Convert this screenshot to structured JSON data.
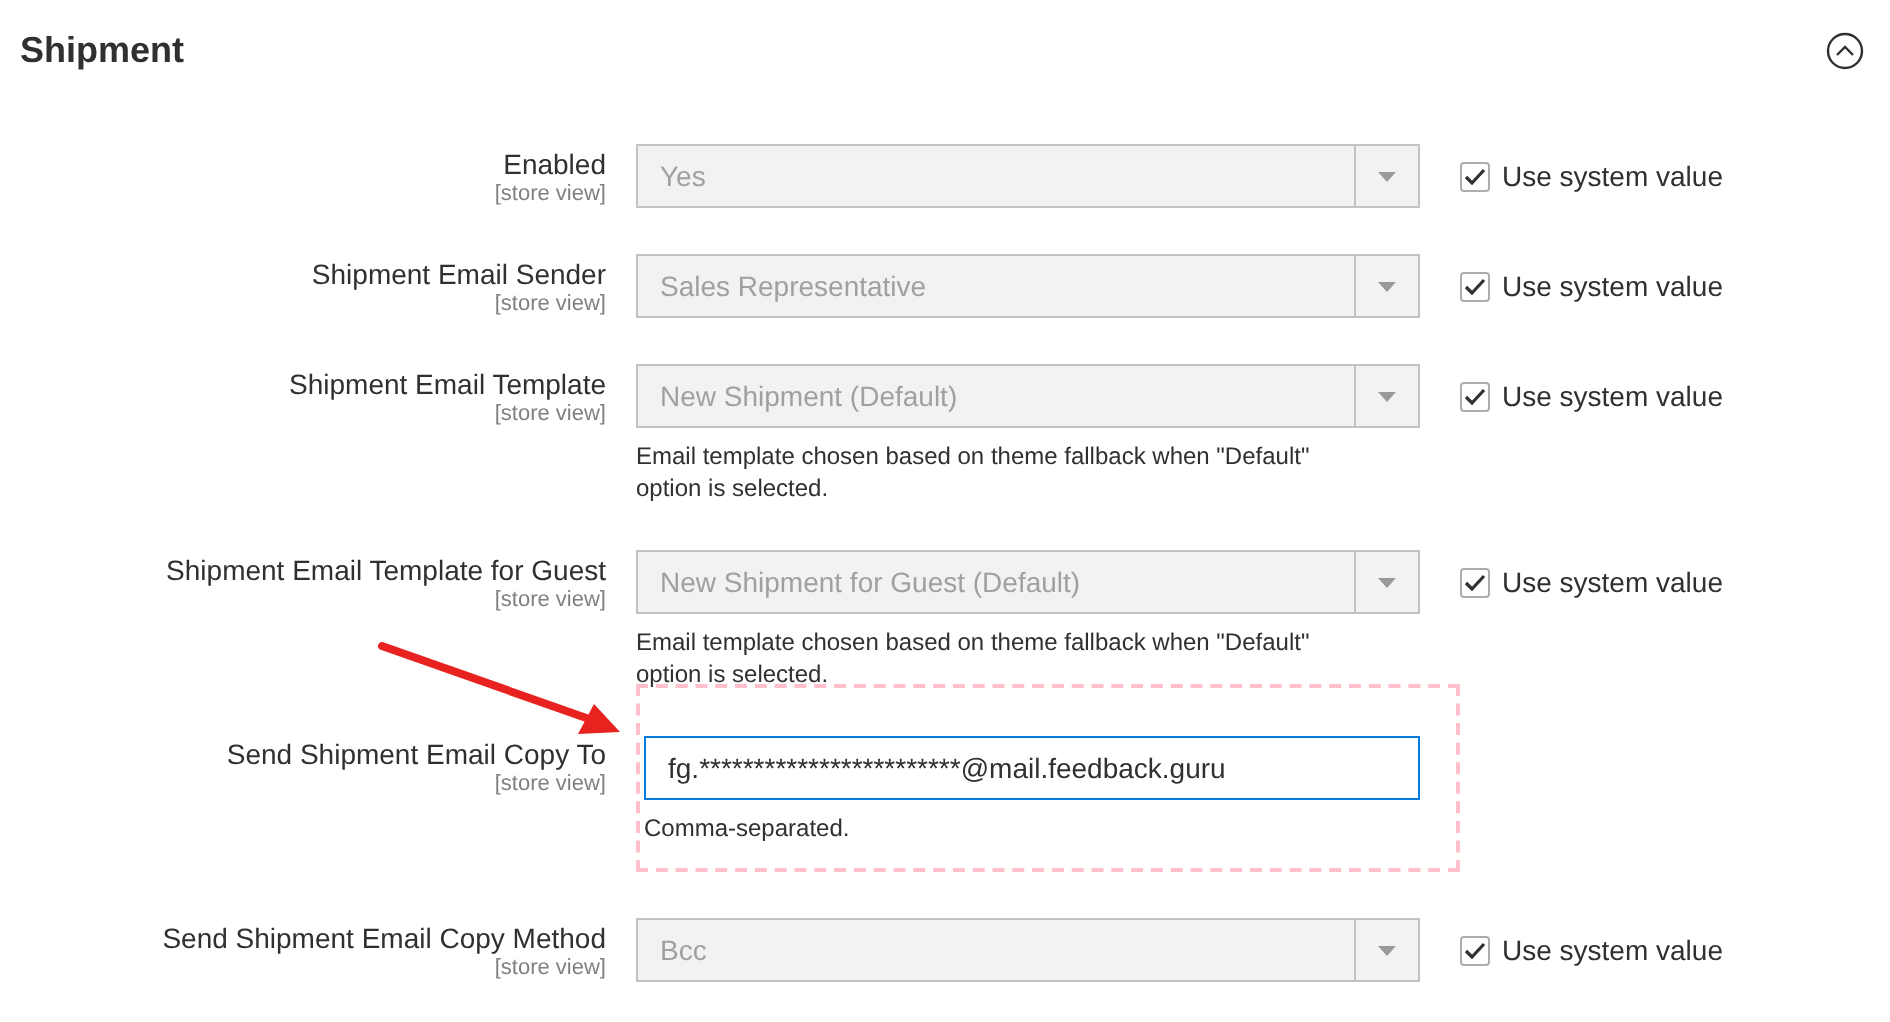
{
  "section": {
    "title": "Shipment",
    "expanded": true
  },
  "rows": [
    {
      "kind": "select",
      "label": "Enabled",
      "scope": "[store view]",
      "value": "Yes",
      "disabled": true,
      "use_system_value": {
        "label": "Use system value",
        "checked": true
      }
    },
    {
      "kind": "select",
      "label": "Shipment Email Sender",
      "scope": "[store view]",
      "value": "Sales Representative",
      "disabled": true,
      "use_system_value": {
        "label": "Use system value",
        "checked": true
      }
    },
    {
      "kind": "select",
      "label": "Shipment Email Template",
      "scope": "[store view]",
      "value": "New Shipment (Default)",
      "disabled": true,
      "note": "Email template chosen based on theme fallback when \"Default\" option is selected.",
      "use_system_value": {
        "label": "Use system value",
        "checked": true
      }
    },
    {
      "kind": "select",
      "label": "Shipment Email Template for Guest",
      "scope": "[store view]",
      "value": "New Shipment for Guest (Default)",
      "disabled": true,
      "note": "Email template chosen based on theme fallback when \"Default\" option is selected.",
      "use_system_value": {
        "label": "Use system value",
        "checked": true
      }
    },
    {
      "kind": "text",
      "label": "Send Shipment Email Copy To",
      "scope": "[store view]",
      "value": "fg.************************@mail.feedback.guru",
      "highlighted": true,
      "note": "Comma-separated."
    },
    {
      "kind": "select",
      "label": "Send Shipment Email Copy Method",
      "scope": "[store view]",
      "value": "Bcc",
      "disabled": true,
      "use_system_value": {
        "label": "Use system value",
        "checked": true
      }
    }
  ]
}
